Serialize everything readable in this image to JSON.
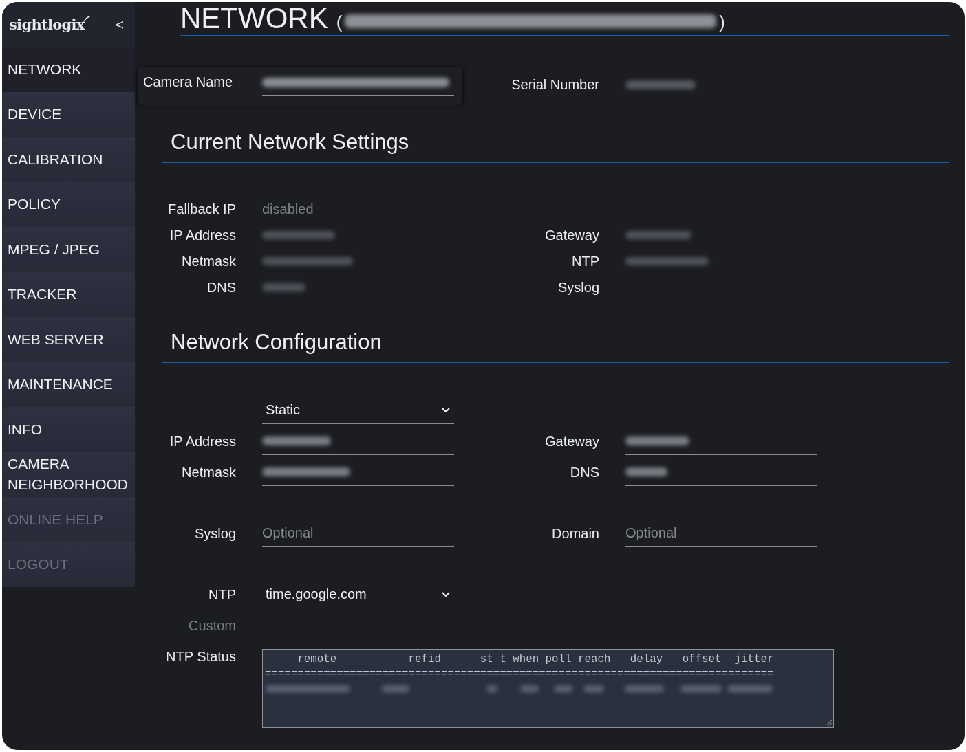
{
  "sidebar": {
    "logo": "sightlogix",
    "collapse_button": "<",
    "items": [
      {
        "label": "NETWORK",
        "selected": true,
        "disabled": false
      },
      {
        "label": "DEVICE",
        "selected": false,
        "disabled": false
      },
      {
        "label": "CALIBRATION",
        "selected": false,
        "disabled": false
      },
      {
        "label": "POLICY",
        "selected": false,
        "disabled": false
      },
      {
        "label": "MPEG / JPEG",
        "selected": false,
        "disabled": false
      },
      {
        "label": "TRACKER",
        "selected": false,
        "disabled": false
      },
      {
        "label": "WEB SERVER",
        "selected": false,
        "disabled": false
      },
      {
        "label": "MAINTENANCE",
        "selected": false,
        "disabled": false
      },
      {
        "label": "INFO",
        "selected": false,
        "disabled": false
      },
      {
        "label": "CAMERA NEIGHBORHOOD",
        "selected": false,
        "disabled": false
      },
      {
        "label": "ONLINE HELP",
        "selected": false,
        "disabled": true
      },
      {
        "label": "LOGOUT",
        "selected": false,
        "disabled": true
      }
    ]
  },
  "header": {
    "title": "NETWORK",
    "open_paren": "(",
    "subtitle_redacted": true,
    "close_paren": ")"
  },
  "camera": {
    "name_label": "Camera Name",
    "name_redacted": true,
    "serial_label": "Serial Number",
    "serial_redacted": true
  },
  "current_settings": {
    "heading": "Current Network Settings",
    "rows": [
      {
        "cells": [
          {
            "label": "Fallback IP",
            "value": "disabled"
          }
        ]
      },
      {
        "cells": [
          {
            "label": "IP Address",
            "redacted": true
          },
          {
            "label": "Gateway",
            "redacted": true
          }
        ]
      },
      {
        "cells": [
          {
            "label": "Netmask",
            "redacted": true
          },
          {
            "label": "NTP",
            "redacted": true
          }
        ]
      },
      {
        "cells": [
          {
            "label": "DNS",
            "redacted": true
          },
          {
            "label": "Syslog"
          }
        ]
      }
    ]
  },
  "configuration": {
    "heading": "Network Configuration",
    "groups": [
      {
        "rows": [
          {
            "cells": [
              {
                "kind": "select",
                "value": "Static"
              }
            ]
          },
          {
            "cells": [
              {
                "kind": "input",
                "label": "IP Address",
                "redacted": true
              },
              {
                "kind": "input",
                "label": "Gateway",
                "redacted": true
              }
            ]
          },
          {
            "cells": [
              {
                "kind": "input",
                "label": "Netmask",
                "redacted": true
              },
              {
                "kind": "input",
                "label": "DNS",
                "redacted": true
              }
            ]
          }
        ]
      },
      {
        "rows": [
          {
            "cells": [
              {
                "kind": "input",
                "label": "Syslog",
                "placeholder": "Optional",
                "redacted": false
              },
              {
                "kind": "input",
                "label": "Domain",
                "placeholder": "Optional",
                "redacted": false
              }
            ]
          }
        ]
      },
      {
        "rows": [
          {
            "cells": [
              {
                "kind": "select",
                "label": "NTP",
                "value": "time.google.com"
              }
            ]
          },
          {
            "cells": [
              {
                "kind": "label",
                "label": "Custom",
                "disabled": true
              }
            ]
          },
          {
            "cells": [
              {
                "kind": "textarea",
                "label": "NTP Status",
                "header_line": "remote           refid      st t when poll reach   delay   offset  jitter",
                "separator_line": "==============================================================================",
                "data_redacted": true
              }
            ]
          }
        ]
      }
    ]
  }
}
